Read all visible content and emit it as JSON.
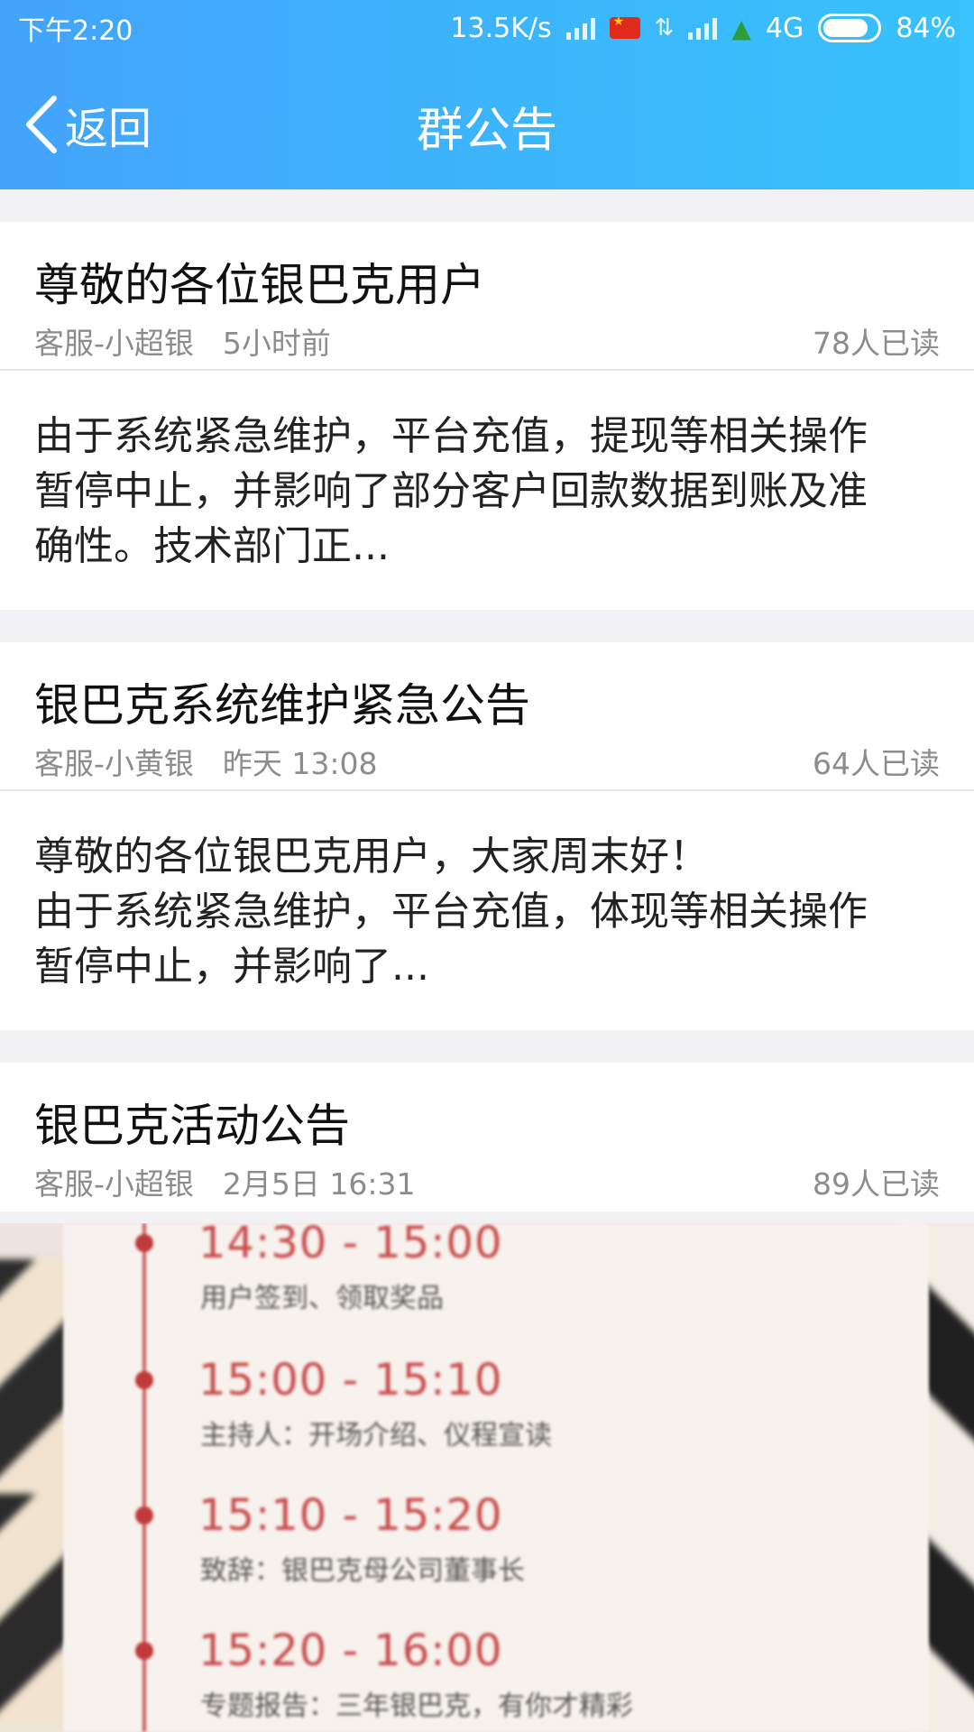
{
  "status_bar": {
    "time": "下午2:20",
    "speed": "13.5K/s",
    "network": "4G",
    "battery": "84%"
  },
  "nav": {
    "back_label": "返回",
    "title": "群公告"
  },
  "announcements": [
    {
      "title": "尊敬的各位银巴克用户",
      "author": "客服-小超银",
      "time": "5小时前",
      "reads": "78人已读",
      "body": "由于系统紧急维护，平台充值，提现等相关操作\n暂停中止，并影响了部分客户回款数据到账及准\n确性。技术部门正..."
    },
    {
      "title": "银巴克系统维护紧急公告",
      "author": "客服-小黄银",
      "time": "昨天 13:08",
      "reads": "64人已读",
      "body": "尊敬的各位银巴克用户，大家周末好！\n由于系统紧急维护，平台充值，体现等相关操作\n暂停中止，并影响了..."
    },
    {
      "title": "银巴克活动公告",
      "author": "客服-小超银",
      "time": "2月5日 16:31",
      "reads": "89人已读"
    }
  ],
  "image": {
    "timeline": [
      {
        "time": "14:30 - 15:00",
        "desc": "用户签到、领取奖品"
      },
      {
        "time": "15:00 - 15:10",
        "desc": "主持人：开场介绍、仪程宣读"
      },
      {
        "time": "15:10 - 15:20",
        "desc": "致辞：银巴克母公司董事长"
      },
      {
        "time": "15:20 - 16:00",
        "desc": "专题报告：三年银巴克，有你才精彩"
      }
    ]
  },
  "colors": {
    "header_start": "#43a3fb",
    "header_end": "#37c2fb",
    "meta_text": "#8c8c8c",
    "timeline_red": "#c84a4a"
  }
}
